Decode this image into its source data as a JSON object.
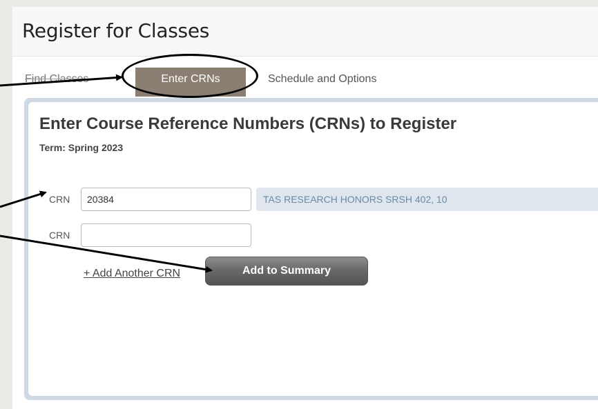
{
  "header": {
    "title": "Register for Classes"
  },
  "tabs": [
    {
      "label": "Find Classes"
    },
    {
      "label": "Enter CRNs"
    },
    {
      "label": "Schedule and Options"
    }
  ],
  "panel": {
    "title": "Enter Course Reference Numbers (CRNs) to Register",
    "term": "Term: Spring 2023",
    "rows": [
      {
        "label": "CRN",
        "value": "20384",
        "course_info": "TAS RESEARCH HONORS SRSH 402, 10"
      },
      {
        "label": "CRN",
        "value": ""
      }
    ],
    "add_another_label": "+ Add Another CRN",
    "add_to_summary_label": "Add to Summary"
  },
  "colors": {
    "active_tab": "#8b7e72",
    "panel_border": "#cfd9e3",
    "course_info_bg": "#dfe6ee",
    "button": "#6a6a6a"
  }
}
